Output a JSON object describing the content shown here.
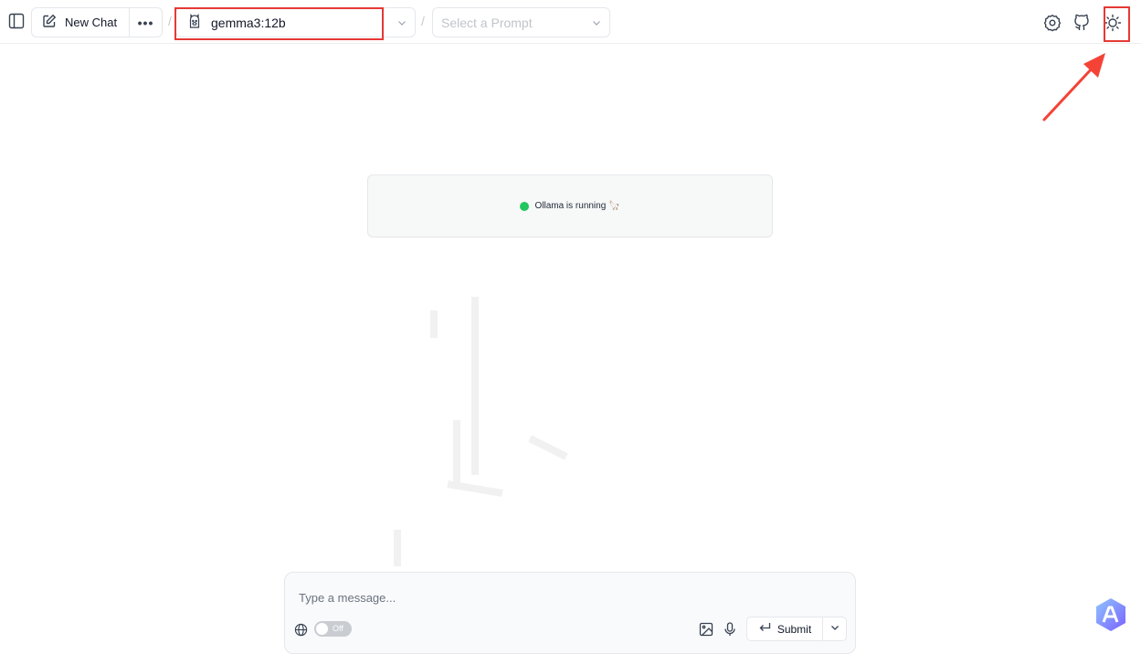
{
  "header": {
    "new_chat_label": "New Chat",
    "more_label": "•••",
    "separator": "/",
    "model": {
      "selected": "gemma3:12b"
    },
    "prompt": {
      "placeholder": "Select a Prompt"
    }
  },
  "status": {
    "text": "Ollama is running 🦙",
    "indicator_color": "#22c55e"
  },
  "composer": {
    "placeholder": "Type a message...",
    "web_search_toggle": "Off",
    "submit_label": "Submit"
  },
  "icons": {
    "sidebar": "sidebar-toggle-icon",
    "new_chat": "edit-icon",
    "model": "llama-icon",
    "settings": "settings-icon",
    "github": "github-icon",
    "theme": "sun-icon",
    "globe": "globe-icon",
    "image": "image-icon",
    "mic": "microphone-icon",
    "enter": "enter-icon"
  },
  "colors": {
    "highlight": "#e53935",
    "accent": "#22c55e"
  }
}
